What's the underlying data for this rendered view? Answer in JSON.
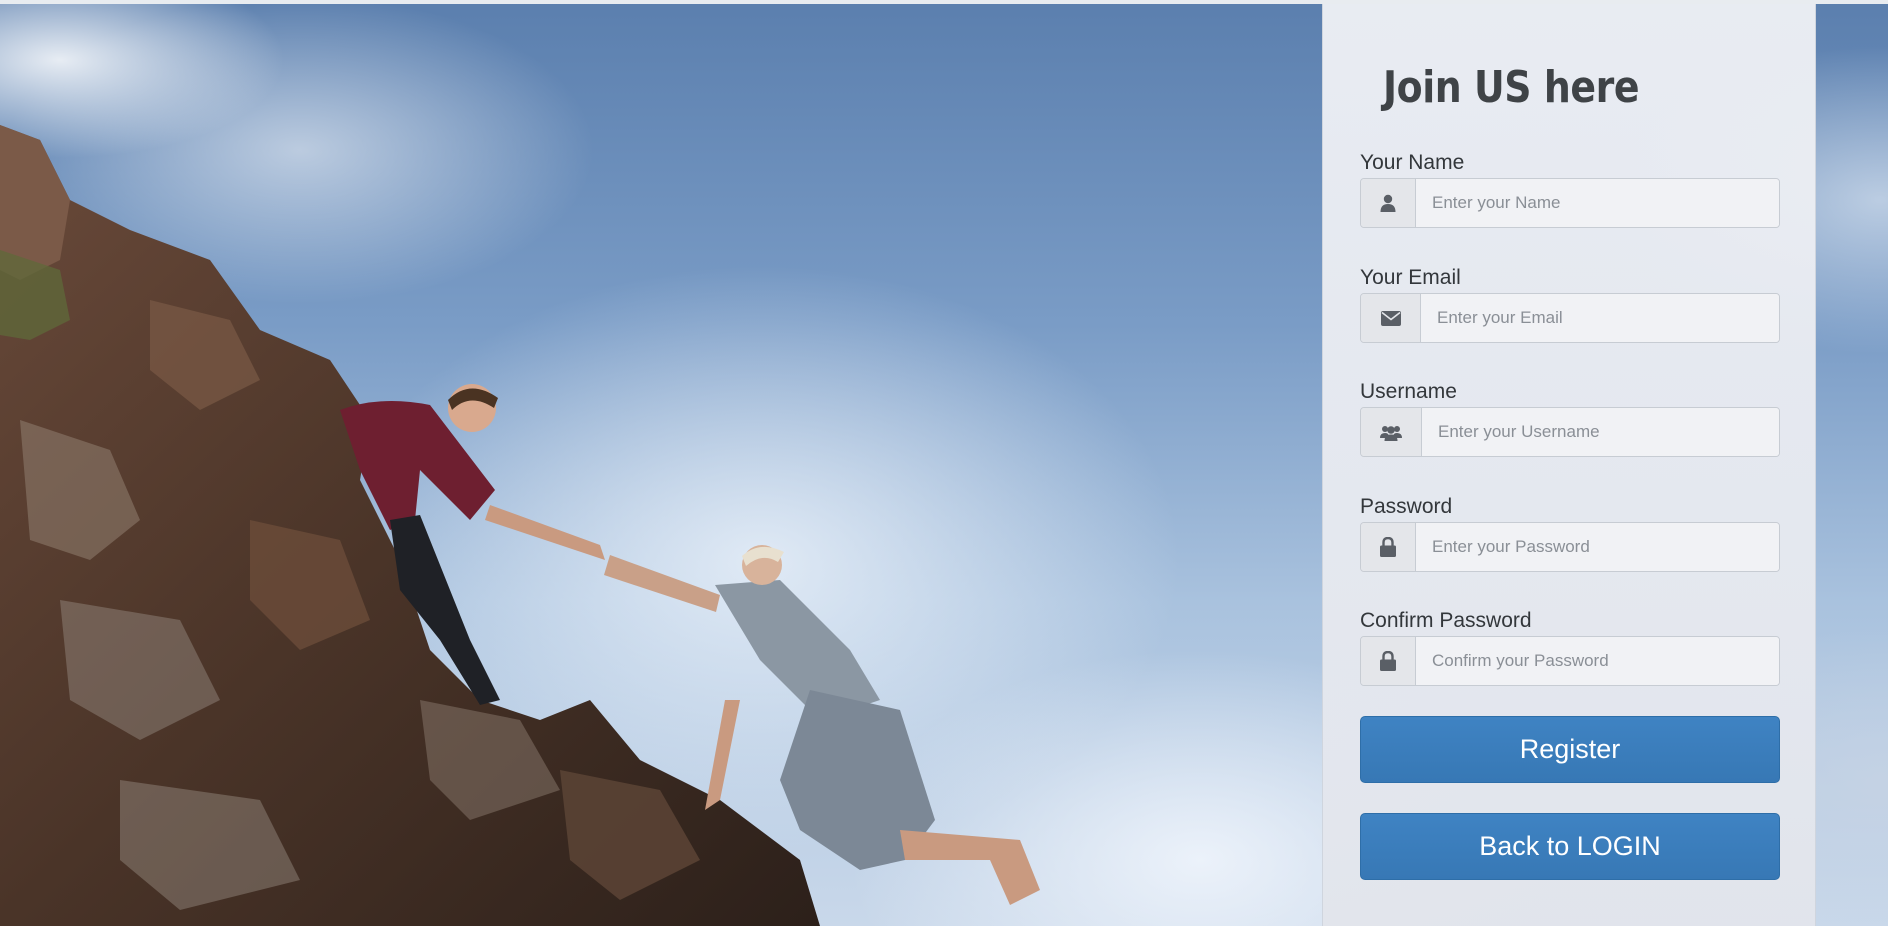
{
  "form": {
    "title": "Join US here",
    "fields": [
      {
        "label": "Your Name",
        "placeholder": "Enter your Name",
        "icon": "user-icon"
      },
      {
        "label": "Your Email",
        "placeholder": "Enter your Email",
        "icon": "envelope-icon"
      },
      {
        "label": "Username",
        "placeholder": "Enter your Username",
        "icon": "users-icon"
      },
      {
        "label": "Password",
        "placeholder": "Enter your Password",
        "icon": "lock-icon"
      },
      {
        "label": "Confirm Password",
        "placeholder": "Confirm your Password",
        "icon": "lock-icon"
      }
    ],
    "register_label": "Register",
    "back_label": "Back to LOGIN"
  },
  "colors": {
    "button": "#3778b5",
    "panel": "#e8eaef",
    "title": "#3f4347"
  }
}
